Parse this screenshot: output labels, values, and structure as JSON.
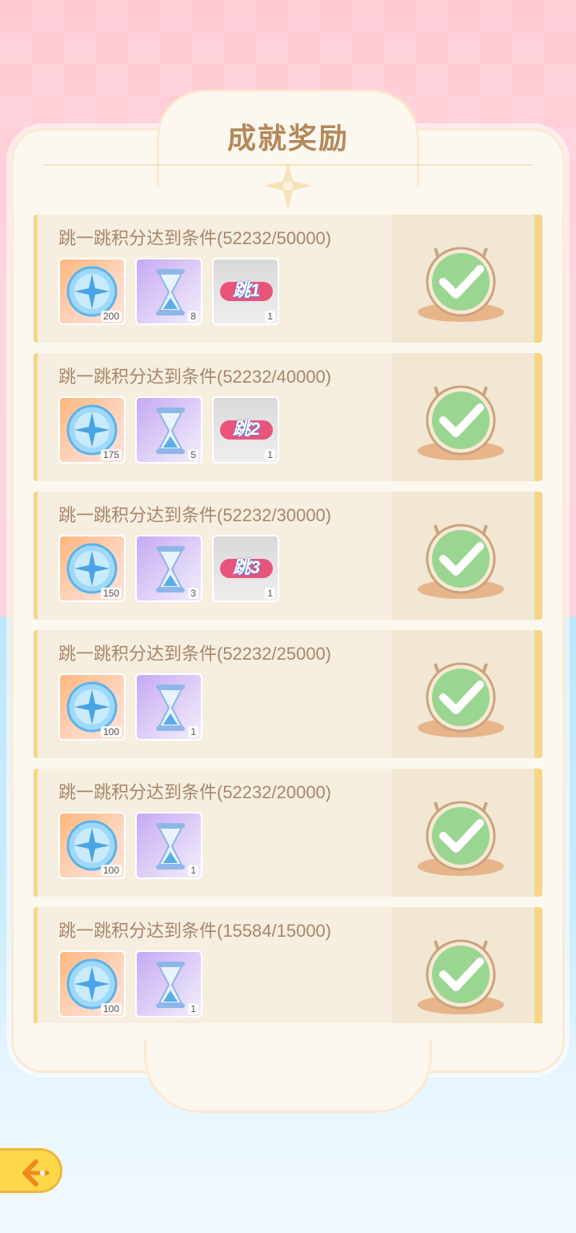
{
  "title": "成就奖励",
  "rows": [
    {
      "condition": "跳一跳积分达到条件(52232/50000)",
      "coin_count": "200",
      "hourglass_count": "8",
      "tag_label": "跳1",
      "tag_count": "1",
      "status_icon": "check-badge-icon"
    },
    {
      "condition": "跳一跳积分达到条件(52232/40000)",
      "coin_count": "175",
      "hourglass_count": "5",
      "tag_label": "跳2",
      "tag_count": "1",
      "status_icon": "check-badge-icon"
    },
    {
      "condition": "跳一跳积分达到条件(52232/30000)",
      "coin_count": "150",
      "hourglass_count": "3",
      "tag_label": "跳3",
      "tag_count": "1",
      "status_icon": "check-badge-icon"
    },
    {
      "condition": "跳一跳积分达到条件(52232/25000)",
      "coin_count": "100",
      "hourglass_count": "1",
      "status_icon": "check-badge-icon"
    },
    {
      "condition": "跳一跳积分达到条件(52232/20000)",
      "coin_count": "100",
      "hourglass_count": "1",
      "status_icon": "check-badge-icon"
    },
    {
      "condition": "跳一跳积分达到条件(15584/15000)",
      "coin_count": "100",
      "hourglass_count": "1",
      "status_icon": "check-badge-icon"
    }
  ],
  "colors": {
    "title": "#b4885a",
    "condition_text": "#a88669",
    "check": "#8fd48a",
    "accent": "#f8d488"
  },
  "back_button_icon": "back-arrow-icon"
}
